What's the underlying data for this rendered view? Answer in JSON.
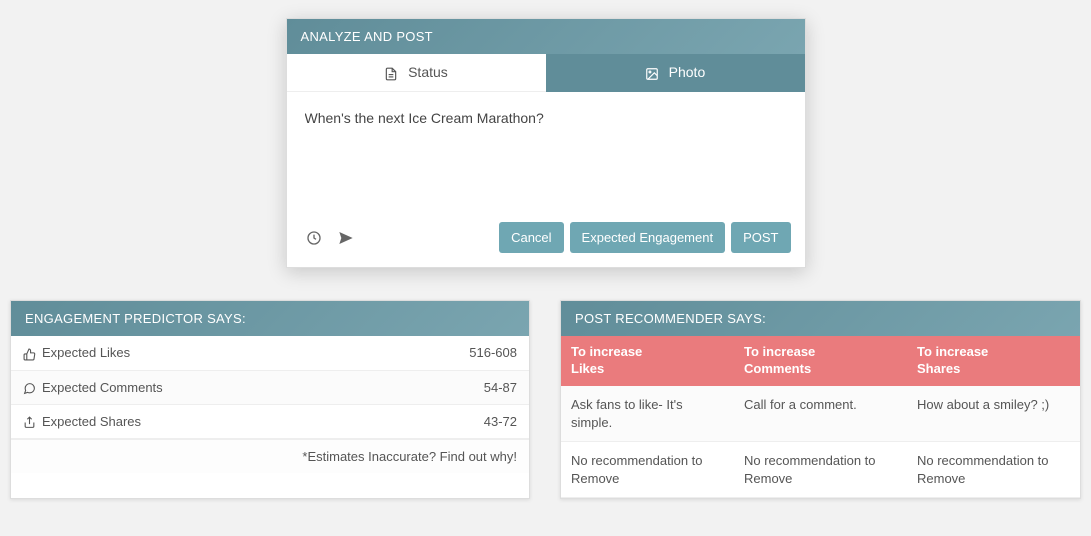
{
  "composer": {
    "title": "ANALYZE AND POST",
    "tabs": {
      "status": "Status",
      "photo": "Photo"
    },
    "text": "When's the next Ice Cream Marathon?",
    "buttons": {
      "cancel": "Cancel",
      "expected": "Expected Engagement",
      "post": "POST"
    }
  },
  "predictor": {
    "title": "ENGAGEMENT PREDICTOR SAYS:",
    "rows": {
      "likes": {
        "label": "Expected Likes",
        "value": "516-608"
      },
      "comments": {
        "label": "Expected Comments",
        "value": "54-87"
      },
      "shares": {
        "label": "Expected Shares",
        "value": "43-72"
      }
    },
    "footer": "*Estimates Inaccurate? Find out why!"
  },
  "recommender": {
    "title": "POST RECOMMENDER SAYS:",
    "headers": {
      "likes1": "To increase",
      "likes2": "Likes",
      "comments1": "To increase",
      "comments2": "Comments",
      "shares1": "To increase",
      "shares2": "Shares"
    },
    "row1": {
      "likes": "Ask fans to like- It's simple.",
      "comments": "Call for a comment.",
      "shares": "How about a smiley? ;)"
    },
    "row2": {
      "likes": "No recommendation to Remove",
      "comments": "No recommendation to Remove",
      "shares": "No recommendation to Remove"
    }
  }
}
